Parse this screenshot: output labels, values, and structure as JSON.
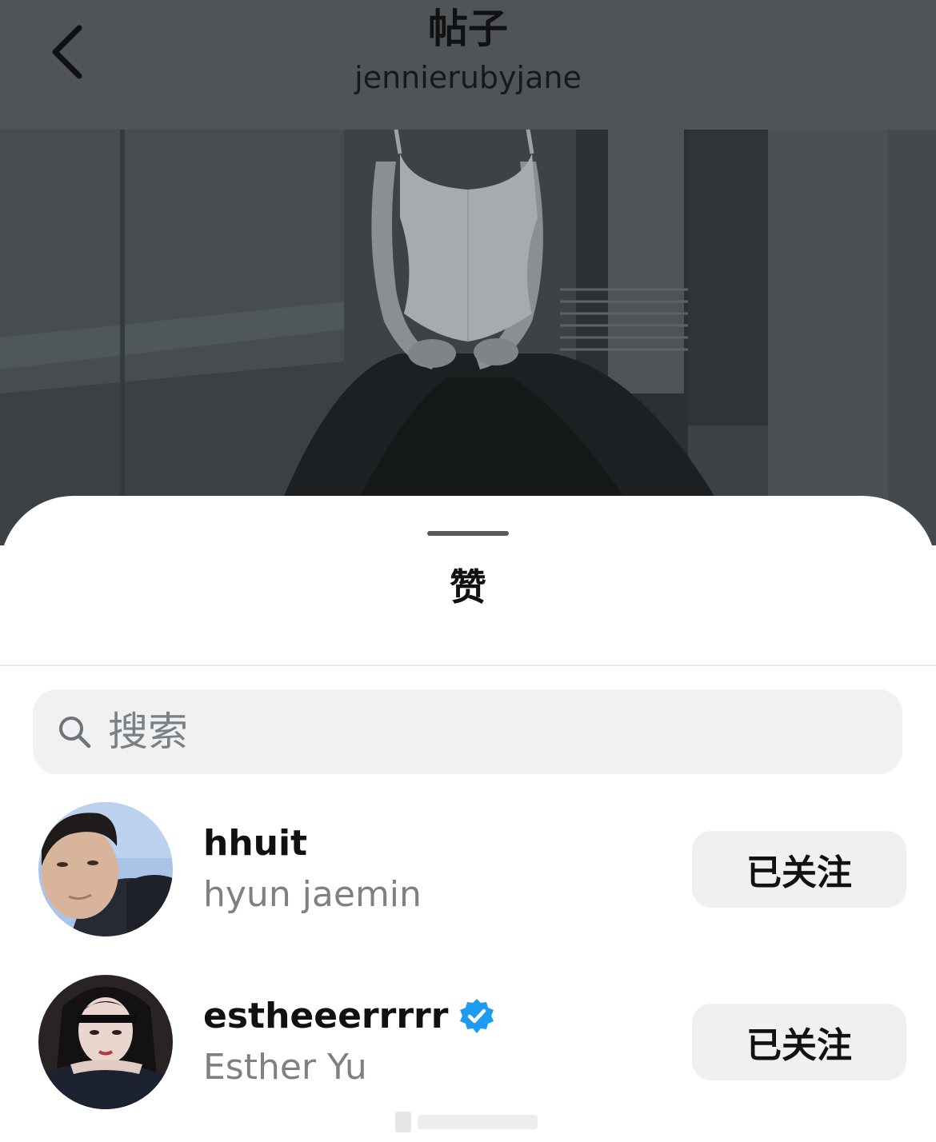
{
  "header": {
    "title": "帖子",
    "subtitle": "jennierubyjane",
    "back_icon": "chevron-left-icon"
  },
  "post": {
    "image_description": "photo-in-white-corset-black-tulle-gown"
  },
  "likes_sheet": {
    "title": "赞",
    "search": {
      "placeholder": "搜索",
      "value": "",
      "icon": "search-icon"
    },
    "users": [
      {
        "username": "hhuit",
        "full_name": "hyun jaemin",
        "verified": false,
        "follow_label": "已关注"
      },
      {
        "username": "estheeerrrrr",
        "full_name": "Esther Yu",
        "verified": true,
        "follow_label": "已关注"
      }
    ]
  },
  "colors": {
    "header_dim": "#4f5458",
    "sheet_bg": "#ffffff",
    "search_bg": "#f0f1f3",
    "button_bg": "#eff0f2",
    "secondary_text": "#7d8186",
    "verified_blue": "#1d9bf0"
  }
}
